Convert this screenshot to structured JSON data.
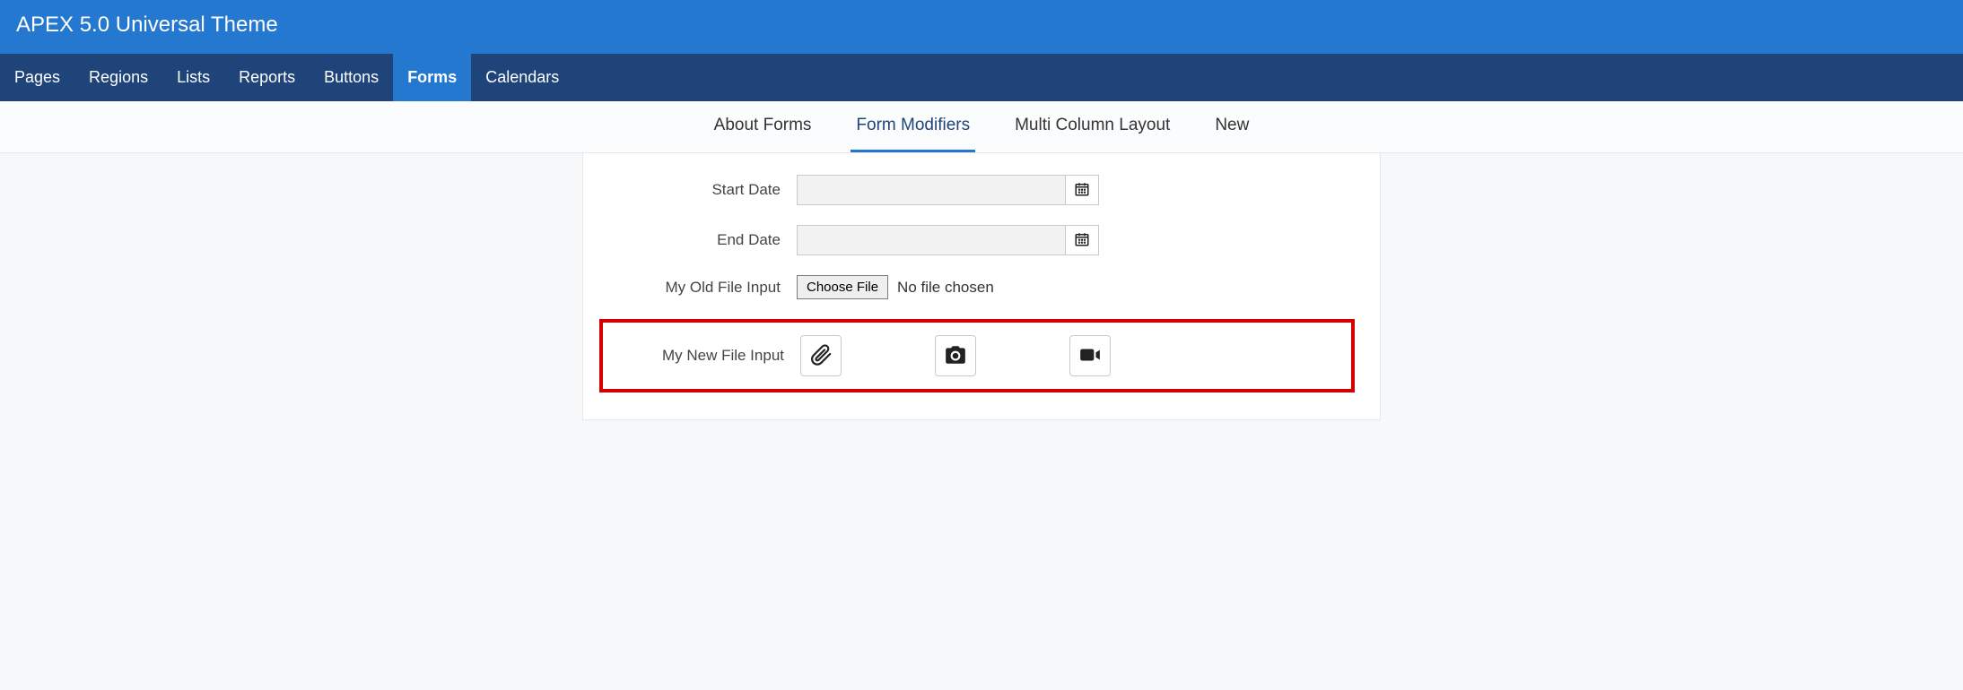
{
  "app_title": "APEX 5.0 Universal Theme",
  "main_nav": {
    "items": [
      {
        "label": "Pages",
        "active": false
      },
      {
        "label": "Regions",
        "active": false
      },
      {
        "label": "Lists",
        "active": false
      },
      {
        "label": "Reports",
        "active": false
      },
      {
        "label": "Buttons",
        "active": false
      },
      {
        "label": "Forms",
        "active": true
      },
      {
        "label": "Calendars",
        "active": false
      }
    ]
  },
  "sub_nav": {
    "items": [
      {
        "label": "About Forms",
        "active": false
      },
      {
        "label": "Form Modifiers",
        "active": true
      },
      {
        "label": "Multi Column Layout",
        "active": false
      },
      {
        "label": "New",
        "active": false
      }
    ]
  },
  "form": {
    "start_date": {
      "label": "Start Date",
      "value": ""
    },
    "end_date": {
      "label": "End Date",
      "value": ""
    },
    "old_file_input": {
      "label": "My Old File Input",
      "button": "Choose File",
      "status": "No file chosen"
    },
    "new_file_input": {
      "label": "My New File Input"
    }
  },
  "icons": {
    "attach": "paperclip-icon",
    "photo": "camera-icon",
    "video": "video-icon"
  },
  "highlight_color": "#d40000"
}
